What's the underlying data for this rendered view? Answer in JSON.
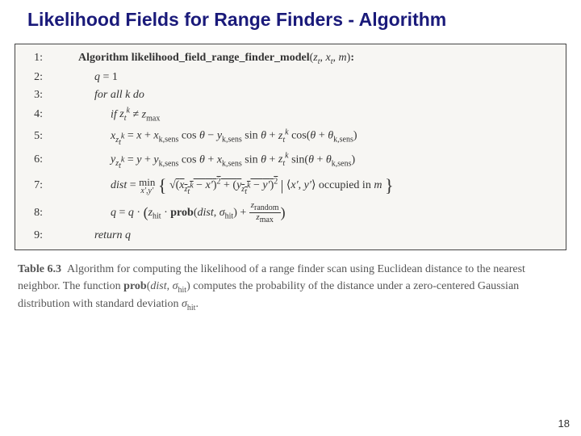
{
  "title": "Likelihood Fields for Range Finders - Algorithm",
  "algo": {
    "header_prefix": "Algorithm likelihood_field_range_finder_model",
    "header_args": "(z_t, x_t, m):",
    "lines": {
      "l1": "1:",
      "l2": "2:",
      "l3": "3:",
      "l4": "4:",
      "l5": "5:",
      "l6": "6:",
      "l7": "7:",
      "l8": "8:",
      "l9": "9:"
    },
    "q_init": "q = 1",
    "for_all": "for all k do",
    "if_cond": "if z_t^k ≠ z_max",
    "eq5": "x_{z_t^k} = x + x_{k,sens} cos θ − y_{k,sens} sin θ + z_t^k cos(θ + θ_{k,sens})",
    "eq6": "y_{z_t^k} = y + y_{k,sens} cos θ + x_{k,sens} sin θ + z_t^k sin(θ + θ_{k,sens})",
    "eq7": "dist = min_{x',y'} { √((x_{z_t^k} − x')² + (y_{z_t^k} − y')²) | ⟨x', y'⟩ occupied in m }",
    "eq8": "q = q · ( z_hit · prob(dist, σ_hit) + z_random / z_max )",
    "return": "return q"
  },
  "caption": {
    "label": "Table 6.3",
    "text": "Algorithm for computing the likelihood of a range finder scan using Euclidean distance to the nearest neighbor. The function prob(dist, σ_hit) computes the probability of the distance under a zero-centered Gaussian distribution with standard deviation σ_hit."
  },
  "page_number": "18"
}
